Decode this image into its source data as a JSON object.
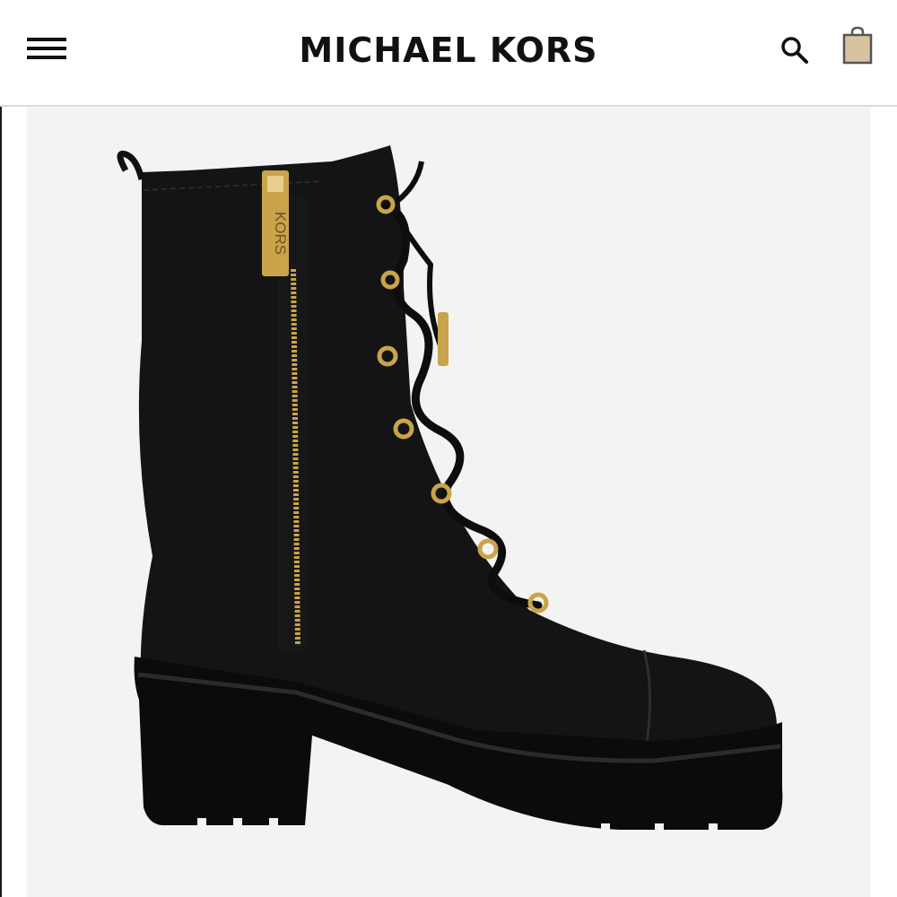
{
  "header": {
    "brand": "MICHAEL KORS",
    "menu_icon": "hamburger-menu-icon",
    "search_icon": "search-icon",
    "bag_icon": "shopping-bag-icon"
  },
  "product_image": {
    "alt": "Black leather lace-up combat boot with gold zipper",
    "zip_pull_text": "KORS",
    "colors": {
      "leather": "#111111",
      "hardware": "#c9a44a",
      "background": "#f3f3f3",
      "bag_fill": "#d8c3a0"
    }
  }
}
